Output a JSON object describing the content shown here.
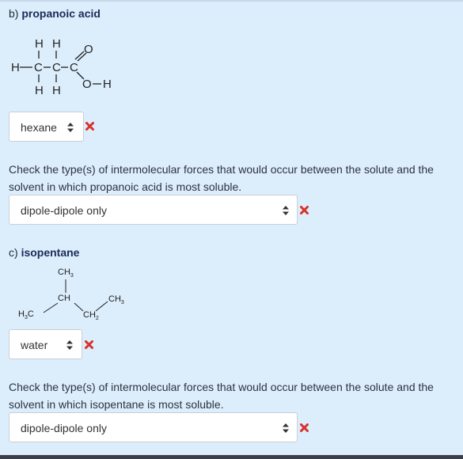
{
  "part_b": {
    "letter": "b)",
    "name": "propanoic acid",
    "structure_atoms": {
      "h_top_1": "H",
      "h_top_2": "H",
      "o_double": "O",
      "h_left": "H",
      "c1": "C",
      "c2": "C",
      "c3": "C",
      "h_bot_1": "H",
      "h_bot_2": "H",
      "oh": "O",
      "oh_h": "H"
    },
    "solvent_select": {
      "value": "hexane"
    },
    "question": "Check the type(s) of intermolecular forces that would occur between the solute and the solvent in which propanoic acid is most soluble.",
    "forces_select": {
      "value": "dipole-dipole only"
    }
  },
  "part_c": {
    "letter": "c)",
    "name": "isopentane",
    "structure_labels": {
      "ch3_top": "CH",
      "ch3_top_sub": "3",
      "ch": "CH",
      "ch3_right": "CH",
      "ch3_right_sub": "3",
      "h3c": "H",
      "h3c_sub": "3",
      "h3c_c": "C",
      "ch2": "CH",
      "ch2_sub": "2"
    },
    "solvent_select": {
      "value": "water"
    },
    "question": "Check the type(s) of intermolecular forces that would occur between the solute and the solvent in which isopentane is most soluble.",
    "forces_select": {
      "value": "dipole-dipole only"
    }
  },
  "colors": {
    "background": "#dcedfb",
    "wrong_mark": "#d9322b",
    "title": "#1a2b5a"
  },
  "icons": {
    "wrong": "x-mark-icon",
    "select_arrows": "up-down-arrows-icon"
  }
}
